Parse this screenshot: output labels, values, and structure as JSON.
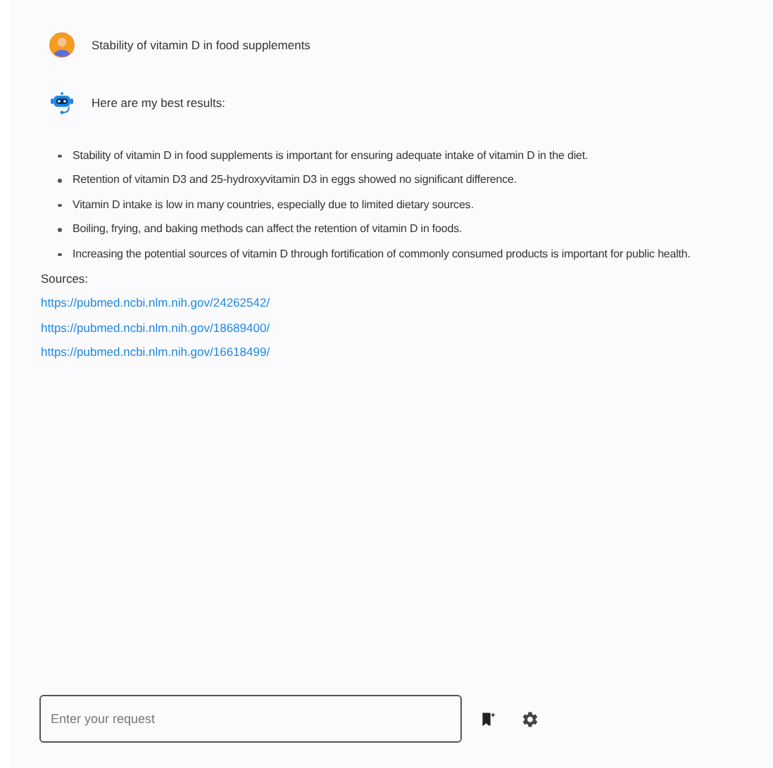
{
  "messages": [
    {
      "kind": "user",
      "text": "Stability of vitamin D in food supplements"
    },
    {
      "kind": "bot",
      "text": "Here are my best results:"
    }
  ],
  "results": [
    "Stability of vitamin D in food supplements is important for ensuring adequate intake of vitamin D in the diet.",
    "Retention of vitamin D3 and 25-hydroxyvitamin D3 in eggs showed no significant difference.",
    "Vitamin D intake is low in many countries, especially due to limited dietary sources.",
    "Boiling, frying, and baking methods can affect the retention of vitamin D in foods.",
    "Increasing the potential sources of vitamin D through fortification of commonly consumed products is important for public health."
  ],
  "sources_label": "Sources:",
  "sources": [
    "https://pubmed.ncbi.nlm.nih.gov/24262542/",
    "https://pubmed.ncbi.nlm.nih.gov/18689400/",
    "https://pubmed.ncbi.nlm.nih.gov/16618499/"
  ],
  "input": {
    "placeholder": "Enter your request"
  }
}
